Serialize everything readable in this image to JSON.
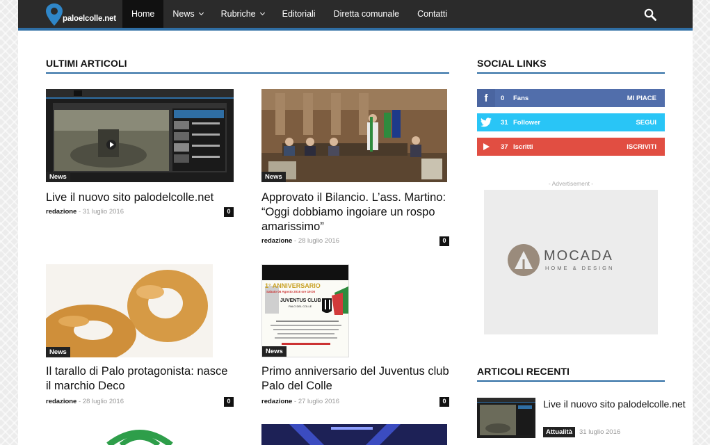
{
  "site": {
    "logo_text": "paloelcolle.net"
  },
  "nav": {
    "items": [
      {
        "label": "Home",
        "active": true,
        "dropdown": false
      },
      {
        "label": "News",
        "active": false,
        "dropdown": true
      },
      {
        "label": "Rubriche",
        "active": false,
        "dropdown": true
      },
      {
        "label": "Editoriali",
        "active": false,
        "dropdown": false
      },
      {
        "label": "Diretta comunale",
        "active": false,
        "dropdown": false
      },
      {
        "label": "Contatti",
        "active": false,
        "dropdown": false
      }
    ],
    "search_icon": "search-icon"
  },
  "main": {
    "block_title": "ULTIMI ARTICOLI",
    "articles": [
      {
        "category": "News",
        "title": "Live il nuovo sito palodelcolle.net",
        "author": "redazione",
        "date": "31 luglio 2016",
        "comments": "0"
      },
      {
        "category": "News",
        "title": "Approvato il Bilancio. L’ass. Martino: “Oggi dobbiamo ingoiare un rospo amarissimo”",
        "author": "redazione",
        "date": "28 luglio 2016",
        "comments": "0"
      },
      {
        "category": "News",
        "title": "Il tarallo di Palo protagonista: nasce il marchio Deco",
        "author": "redazione",
        "date": "28 luglio 2016",
        "comments": "0"
      },
      {
        "category": "News",
        "title": "Primo anniversario del Juventus club Palo del Colle",
        "author": "redazione",
        "date": "27 luglio 2016",
        "comments": "0"
      }
    ],
    "poster": {
      "line1": "1° ANNIVERSARIO",
      "line2": "Sabato 06 Agosto 2016 ore 19:00",
      "line3": "JUVENTUS CLUB",
      "line4": "PALO DEL COLLE"
    }
  },
  "sidebar": {
    "social_title": "SOCIAL LINKS",
    "social": [
      {
        "network": "facebook",
        "icon": "facebook-icon",
        "count": "0",
        "label": "Fans",
        "action": "MI PIACE",
        "color": "#516eab"
      },
      {
        "network": "twitter",
        "icon": "twitter-icon",
        "count": "31",
        "label": "Follower",
        "action": "SEGUI",
        "color": "#29c5f6"
      },
      {
        "network": "youtube",
        "icon": "youtube-icon",
        "count": "37",
        "label": "Iscritti",
        "action": "ISCRIVITI",
        "color": "#e14e42"
      }
    ],
    "ad_label": "- Advertisement -",
    "ad_brand": "MOCADA",
    "ad_sub": "HOME & DESIGN",
    "recent_title": "ARTICOLI RECENTI",
    "recent": [
      {
        "title": "Live il nuovo sito palodelcolle.net",
        "category": "Attualità",
        "date": "31 luglio 2016"
      }
    ]
  },
  "colors": {
    "accent": "#2f6ea4",
    "nav_bg": "#2b2b2b"
  }
}
